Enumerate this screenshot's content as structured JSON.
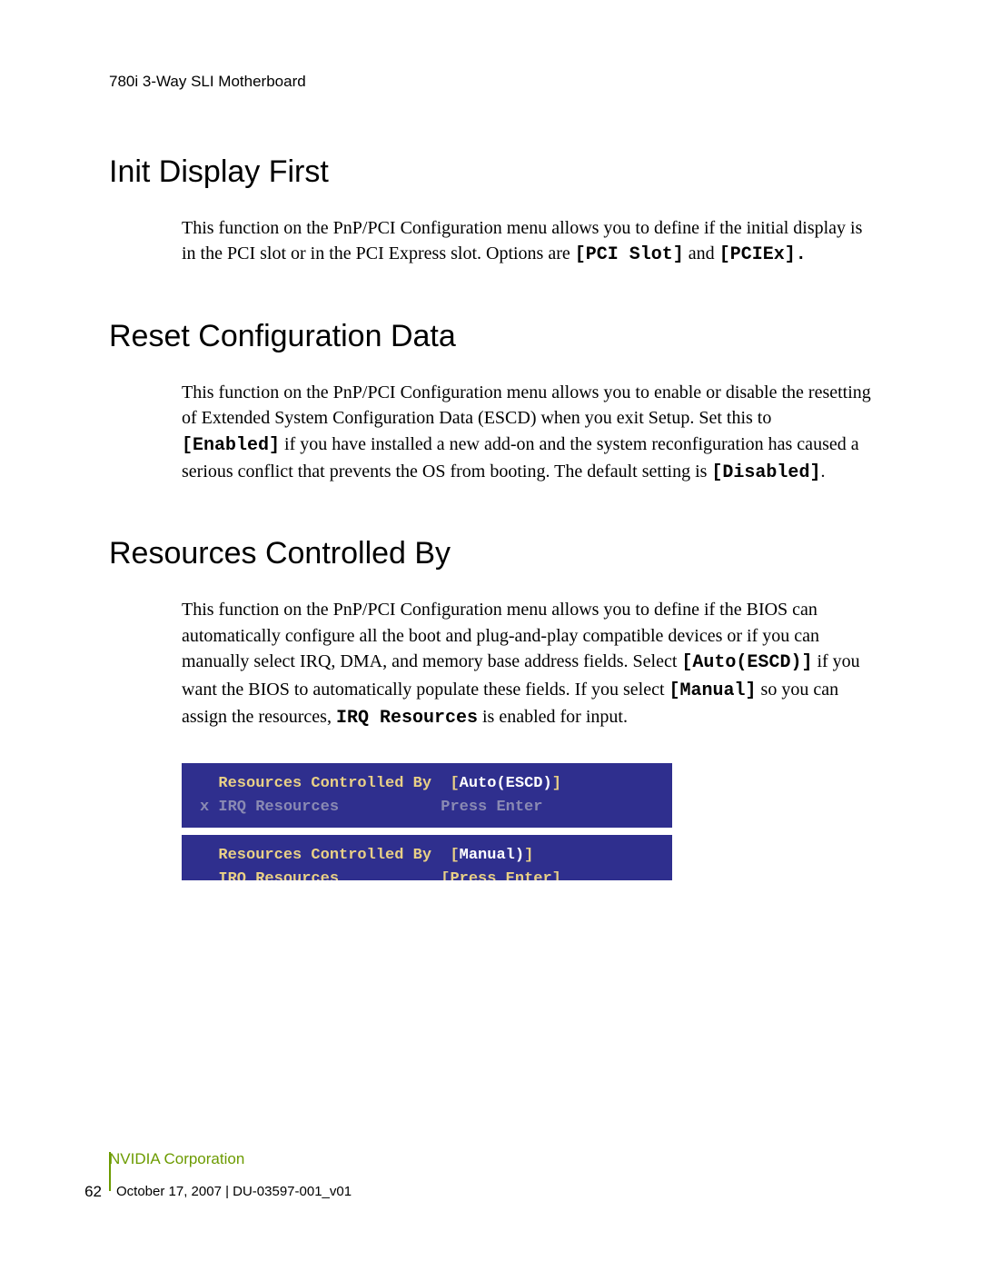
{
  "header": "780i 3-Way SLI Motherboard",
  "sections": {
    "init": {
      "title": "Init Display First",
      "p1a": "This function on the PnP/PCI Configuration menu allows you to define if the initial display is in the PCI slot or in the PCI Express slot. Options are ",
      "code1": "[PCI Slot]",
      "p1b": " and ",
      "code2": "[PCIEx]."
    },
    "reset": {
      "title": "Reset Configuration Data",
      "p1a": "This function on the PnP/PCI Configuration menu allows you to enable or disable the resetting of Extended System Configuration Data (ESCD) when you exit Setup. Set this to ",
      "code1": "[Enabled]",
      "p1b": " if you have installed a new add-on and the system reconfiguration has caused a serious conflict that prevents the OS from booting. The default setting is ",
      "code2": "[Disabled]",
      "p1c": "."
    },
    "resources": {
      "title": "Resources Controlled By",
      "p1a": "This function on the PnP/PCI Configuration menu allows you to define if the BIOS can automatically configure all the boot and plug-and-play compatible devices or if you can manually select IRQ, DMA, and memory base address fields. Select ",
      "code1": "[Auto(ESCD)]",
      "p1b": " if you want the BIOS to automatically populate these fields. If you select ",
      "code2": "[Manual]",
      "p1c": " so you can assign the resources, ",
      "code3": "IRQ Resources",
      "p1d": " is enabled for input."
    }
  },
  "codebox1": {
    "line1a": "  Resources Controlled By  [",
    "line1b": "Auto(ESCD)",
    "line1c": "]",
    "line2a": "x",
    "line2b": " IRQ Resources           Press Enter"
  },
  "codebox2": {
    "line1a": "  Resources Controlled By  [",
    "line1b": "Manual)",
    "line1c": "]",
    "line2a": "  IRQ Resources           ",
    "line2b": "[Press Enter]"
  },
  "footer": {
    "company": "NVIDIA Corporation",
    "page": "62",
    "date": "October 17, 2007  |  DU-03597-001_v01"
  }
}
